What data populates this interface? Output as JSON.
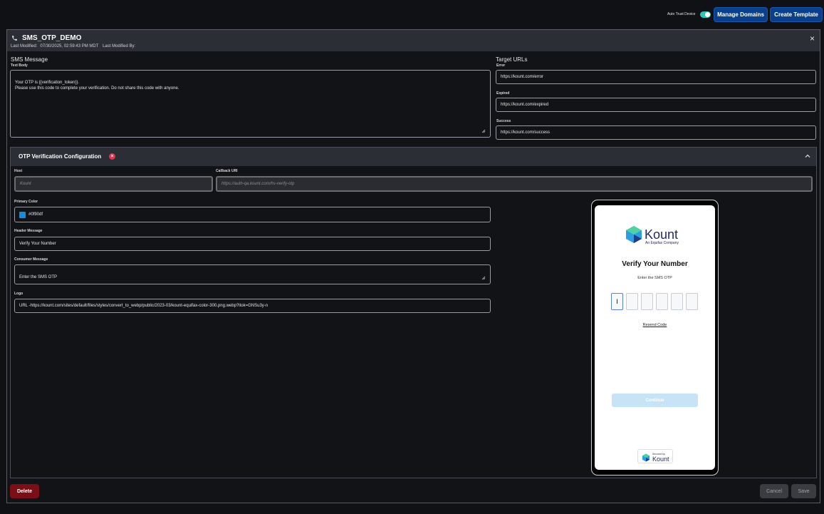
{
  "topbar": {
    "auto_trust_label": "Auto Trust Device",
    "auto_trust_on": true,
    "manage_domains": "Manage Domains",
    "create_template": "Create Template"
  },
  "panel": {
    "title": "SMS_OTP_DEMO",
    "last_modified_label": "Last Modified:",
    "last_modified_value": "07/30/2025, 02:59:43 PM MDT",
    "last_modified_by_label": "Last Modified By:",
    "close": "×"
  },
  "sms": {
    "section_title": "SMS Message",
    "text_body_label": "Text Body",
    "text_body": "Your OTP is {{verification_token}}.\nPlease use this code to complete your verification. Do not share this code with anyone."
  },
  "target_urls": {
    "section_title": "Target URLs",
    "error_label": "Error",
    "error_value": "https://kount.com/error",
    "expired_label": "Expired",
    "expired_value": "https://kount.com/expired",
    "success_label": "Success",
    "success_value": "https://kount.com/success"
  },
  "otp_config": {
    "title": "OTP Verification Configuration",
    "host_label": "Host",
    "host_placeholder": "Kount",
    "callback_label": "Callback URI",
    "callback_placeholder": "https://auth-qa.kount.com/hs-verify-otp",
    "primary_color_label": "Primary Color",
    "primary_color_value": "#0f90df",
    "header_message_label": "Header Message",
    "header_message_value": "Verify Your Number",
    "consumer_message_label": "Consumer Message",
    "consumer_message_value": "Enter the SMS OTP",
    "logo_label": "Logo",
    "logo_value": "URL  -https://kount.com/sites/default/files/styles/convert_to_webp/public/2023-03/kount-equifax-color-300.png.webp?itok=GNSu3y-n"
  },
  "preview": {
    "logo_word": "Kount",
    "logo_sub": "An Equifax Company",
    "header": "Verify Your Number",
    "consumer": "Enter the SMS OTP",
    "otp_first": "I",
    "resend": "Resend Code",
    "continue": "Continue",
    "secured_by": "Secured by",
    "secured_word": "Kount"
  },
  "actions": {
    "delete": "Delete",
    "cancel": "Cancel",
    "save": "Save"
  },
  "colors": {
    "primary": "#0f90df",
    "accent_button": "#0a3f8a",
    "delete": "#7a0f17",
    "toggle_on": "#2ec4b6"
  }
}
